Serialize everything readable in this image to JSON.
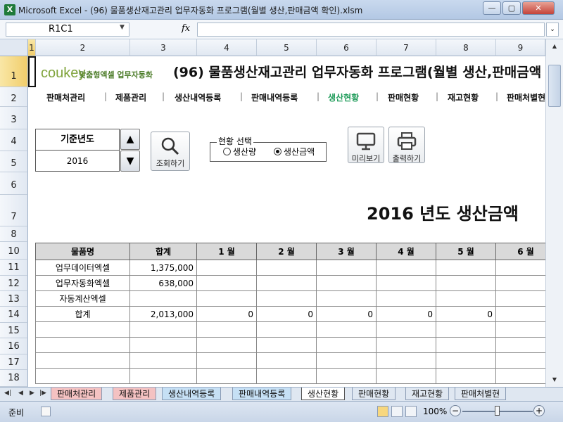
{
  "window": {
    "title": "Microsoft Excel - (96) 물품생산재고관리 업무자동화 프로그램(월별 생산,판매금액 확인).xlsm",
    "app_icon": "X",
    "min_label": "—",
    "max_label": "▢",
    "close_label": "✕"
  },
  "formula_bar": {
    "name_box": "R1C1",
    "fx": "fx",
    "value": ""
  },
  "columns": [
    "1",
    "2",
    "3",
    "4",
    "5",
    "6",
    "7",
    "8",
    "9"
  ],
  "rows": [
    "1",
    "2",
    "3",
    "4",
    "5",
    "6",
    "7",
    "8",
    "10",
    "11",
    "12",
    "13",
    "14",
    "15",
    "16",
    "17",
    "18"
  ],
  "brand": {
    "logo": "coukey",
    "tagline": "맞춤형엑셀 업무자동화",
    "banner": "(96) 물품생산재고관리 업무자동화 프로그램(월별 생산,판매금액"
  },
  "menu": [
    {
      "label": "판매처관리",
      "active": false
    },
    {
      "label": "제품관리",
      "active": false
    },
    {
      "label": "생산내역등록",
      "active": false
    },
    {
      "label": "판매내역등록",
      "active": false
    },
    {
      "label": "생산현황",
      "active": true
    },
    {
      "label": "판매현황",
      "active": false
    },
    {
      "label": "재고현황",
      "active": false
    },
    {
      "label": "판매처별현",
      "active": false
    }
  ],
  "controls": {
    "year_label": "기준년도",
    "year_value": "2016",
    "spin_up": "▲",
    "spin_down": "▼",
    "search_button": "조회하기",
    "preview_button": "미리보기",
    "print_button": "출력하기",
    "radio_legend": "현황 선택",
    "radio_options": [
      {
        "label": "생산량",
        "selected": false
      },
      {
        "label": "생산금액",
        "selected": true
      }
    ]
  },
  "report": {
    "title": "2016 년도 생산금액",
    "headers": [
      "물품명",
      "합계",
      "1 월",
      "2 월",
      "3 월",
      "4 월",
      "5 월",
      "6 월"
    ],
    "rows": [
      [
        "업무데이터엑셀",
        "1,375,000",
        "",
        "",
        "",
        "",
        "",
        ""
      ],
      [
        "업무자동화엑셀",
        "638,000",
        "",
        "",
        "",
        "",
        "",
        ""
      ],
      [
        "자동계산엑셀",
        "",
        "",
        "",
        "",
        "",
        "",
        ""
      ],
      [
        "합계",
        "2,013,000",
        "0",
        "0",
        "0",
        "0",
        "0",
        "0"
      ],
      [
        "",
        "",
        "",
        "",
        "",
        "",
        "",
        ""
      ],
      [
        "",
        "",
        "",
        "",
        "",
        "",
        "",
        ""
      ],
      [
        "",
        "",
        "",
        "",
        "",
        "",
        "",
        ""
      ],
      [
        "",
        "",
        "",
        "",
        "",
        "",
        "",
        ""
      ]
    ]
  },
  "sheet_tabs": [
    {
      "label": "판매처관리",
      "color": "#f4c2c2",
      "active": false
    },
    {
      "label": "제품관리",
      "color": "#f4c2c2",
      "active": false
    },
    {
      "label": "생산내역등록",
      "color": "#c6e0f5",
      "active": false
    },
    {
      "label": "판매내역등록",
      "color": "#c6e0f5",
      "active": false
    },
    {
      "label": "생산현황",
      "color": "#ffffff",
      "active": true
    },
    {
      "label": "판매현황",
      "color": "#dfe7f1",
      "active": false
    },
    {
      "label": "재고현황",
      "color": "#dfe7f1",
      "active": false
    },
    {
      "label": "판매처별현",
      "color": "#dfe7f1",
      "active": false
    }
  ],
  "status": {
    "mode": "준비",
    "zoom": "100%",
    "zoom_minus": "−",
    "zoom_plus": "+"
  }
}
